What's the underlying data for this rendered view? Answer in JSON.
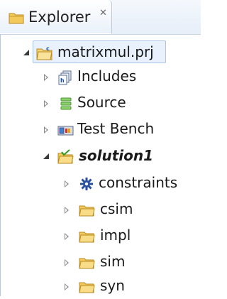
{
  "tab": {
    "title": "Explorer",
    "close_glyph": "✕"
  },
  "tree": {
    "project": {
      "label": "matrixmul.prj",
      "icon": "project-folder-icon",
      "expanded": true
    },
    "items": [
      {
        "label": "Includes",
        "icon": "includes-icon",
        "expanded": false
      },
      {
        "label": "Source",
        "icon": "source-icon",
        "expanded": false
      },
      {
        "label": "Test Bench",
        "icon": "test-bench-icon",
        "expanded": false
      },
      {
        "label": "solution1",
        "icon": "solution-folder-icon",
        "expanded": true,
        "children": [
          {
            "label": "constraints",
            "icon": "constraints-icon",
            "expanded": false
          },
          {
            "label": "csim",
            "icon": "folder-icon",
            "expanded": false
          },
          {
            "label": "impl",
            "icon": "folder-icon",
            "expanded": false
          },
          {
            "label": "sim",
            "icon": "folder-icon",
            "expanded": false
          },
          {
            "label": "syn",
            "icon": "folder-icon",
            "expanded": false
          }
        ]
      }
    ]
  },
  "colors": {
    "folder": "#e9b94a",
    "selection_border": "#a9c6ea",
    "selection_fill": "#e8f1fc",
    "accent_green": "#4a9a2e",
    "blue": "#1f4e9e"
  }
}
